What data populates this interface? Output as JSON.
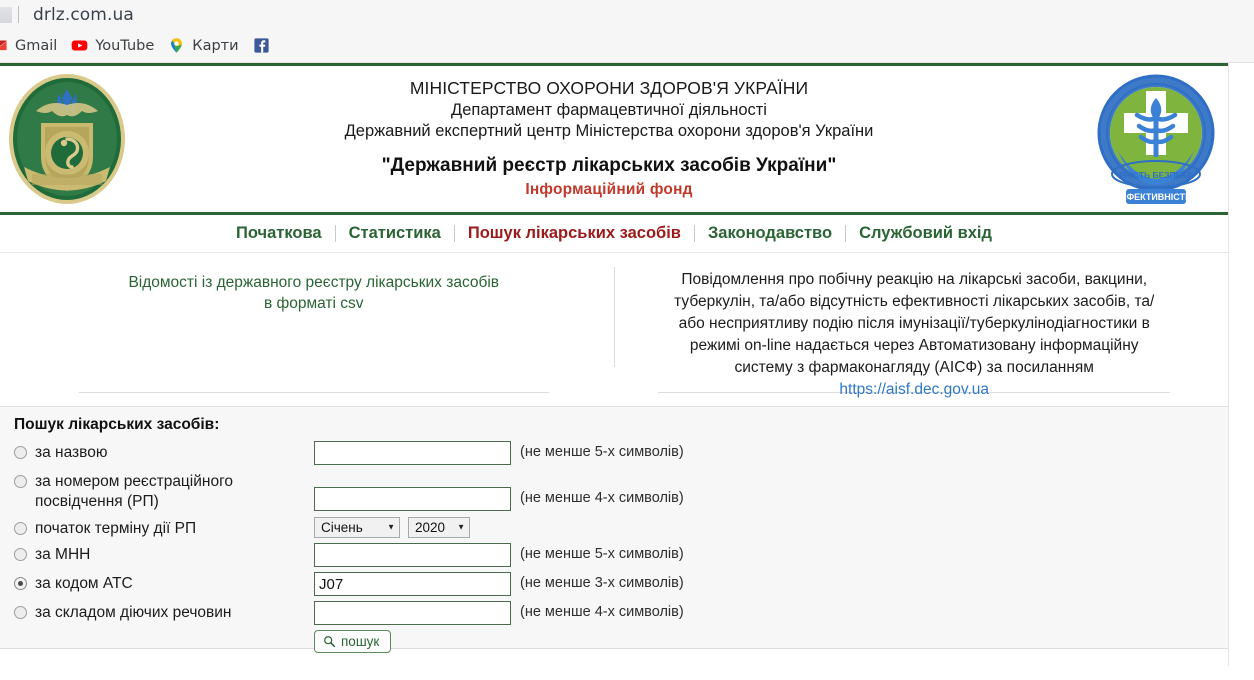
{
  "browser": {
    "url": "drlz.com.ua",
    "bookmarks": [
      {
        "label": "Gmail",
        "icon": "gmail-icon"
      },
      {
        "label": "YouTube",
        "icon": "youtube-icon"
      },
      {
        "label": "Карти",
        "icon": "google-maps-icon"
      },
      {
        "label": "",
        "icon": "facebook-icon"
      }
    ]
  },
  "header": {
    "logo_left_alt": "ministry-of-health-emblem",
    "logo_right_alt": "state-expert-center-emblem",
    "line1": "МІНІСТЕРСТВО ОХОРОНИ ЗДОРОВ'Я УКРАЇНИ",
    "line2": "Департамент фармацевтичної діяльності",
    "line3": "Державний експертний центр Міністерства охорони здоров'я України",
    "line4": "\"Державний реєстр лікарських засобів України\"",
    "line5": "Інформаційний фонд",
    "accent_green": "#2a6434",
    "accent_red": "#c0392b"
  },
  "nav": {
    "items": [
      {
        "label": "Початкова",
        "active": false
      },
      {
        "label": "Статистика",
        "active": false
      },
      {
        "label": "Пошук лікарських засобів",
        "active": true
      },
      {
        "label": "Законодавство",
        "active": false
      },
      {
        "label": "Службовий вхід",
        "active": false
      }
    ]
  },
  "info": {
    "csv_line1": "Відомості із державного реєстру лікарських засобів",
    "csv_line2": "в форматі csv",
    "aisf_text": "Повідомлення про побічну реакцію на лікарські засоби, вакцини, туберкулін, та/або відсутність ефективності лікарських засобів, та/або несприятливу подію після імунізації/туберкулінодіагностики в режимі on-line надається через Автоматизовану інформаційну систему з фармаконагляду (АІСФ) за посиланням ",
    "aisf_link": "https://aisf.dec.gov.ua"
  },
  "search_form": {
    "title": "Пошук лікарських засобів:",
    "rows": [
      {
        "id": "by-name",
        "label": "за назвою",
        "type": "text",
        "value": "",
        "hint": "(не менше 5-х символів)",
        "checked": false
      },
      {
        "id": "by-registration-number",
        "label": "за номером реєстраційного посвідчення (РП)",
        "type": "text",
        "value": "",
        "hint": "(не менше 4-х символів)",
        "checked": false
      },
      {
        "id": "by-rp-start-date",
        "label": "початок терміну дії РП",
        "type": "selects",
        "month": "Січень",
        "year": "2020",
        "hint": "",
        "checked": false
      },
      {
        "id": "by-inn",
        "label": "за МНН",
        "type": "text",
        "value": "",
        "hint": "(не менше 5-х символів)",
        "checked": false
      },
      {
        "id": "by-atc-code",
        "label": "за кодом ATC",
        "type": "text",
        "value": "J07",
        "hint": "(не менше 3-х символів)",
        "checked": true
      },
      {
        "id": "by-active-substance",
        "label": "за складом діючих речовин",
        "type": "text",
        "value": "",
        "hint": "(не менше 4-х символів)",
        "checked": false
      }
    ],
    "submit_label": "пошук",
    "submit_icon": "magnifier-icon"
  }
}
